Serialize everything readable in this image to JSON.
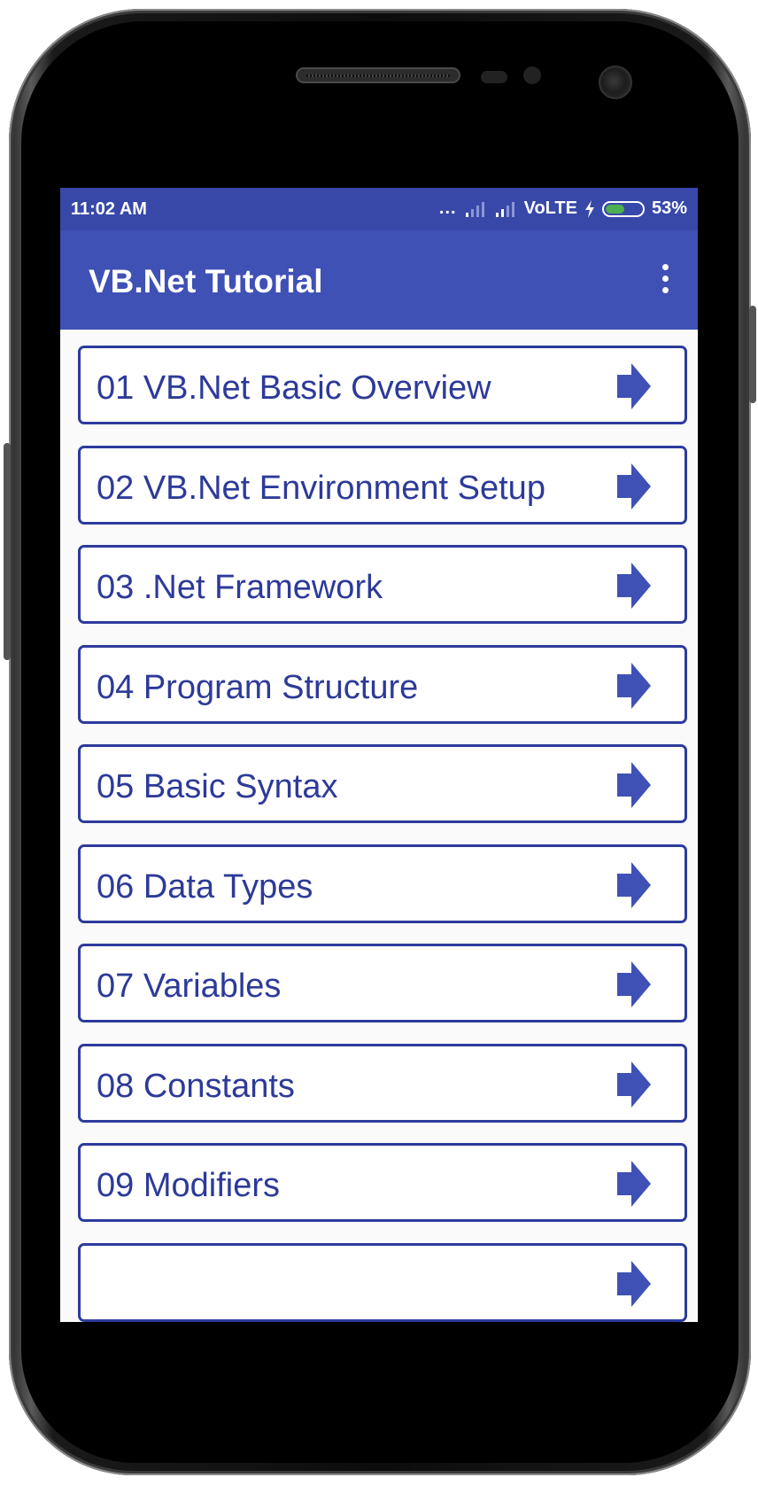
{
  "status_bar": {
    "time": "11:02 AM",
    "dots": "...",
    "network": "VoLTE",
    "battery_level": 0.53,
    "battery_text": "53%",
    "battery_color": "#4caf50"
  },
  "app_bar": {
    "title": "VB.Net Tutorial",
    "menu_icon": "more-vert-icon"
  },
  "colors": {
    "primary": "#3f51b5",
    "primary_dark": "#3748a8",
    "item_text": "#2d3a99",
    "item_border": "#2c3b9c"
  },
  "list": {
    "item_icon": "arrow-right-icon",
    "items": [
      {
        "label": "01 VB.Net Basic Overview"
      },
      {
        "label": "02 VB.Net Environment Setup"
      },
      {
        "label": "03 .Net Framework"
      },
      {
        "label": "04 Program Structure"
      },
      {
        "label": "05 Basic Syntax"
      },
      {
        "label": "06 Data Types"
      },
      {
        "label": "07 Variables"
      },
      {
        "label": "08 Constants"
      },
      {
        "label": "09 Modifiers"
      },
      {
        "label": ""
      }
    ]
  }
}
